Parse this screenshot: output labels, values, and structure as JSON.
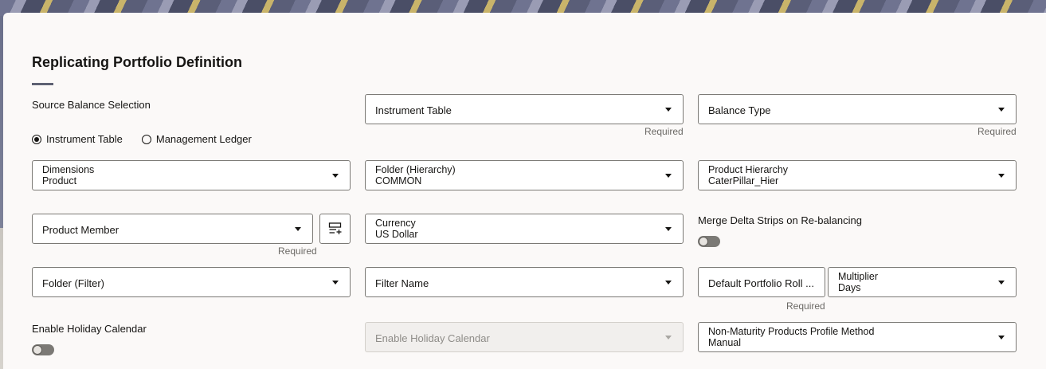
{
  "page": {
    "title": "Replicating Portfolio Definition"
  },
  "source_balance": {
    "label": "Source Balance Selection",
    "options": [
      "Instrument Table",
      "Management Ledger"
    ],
    "selected": "Instrument Table"
  },
  "instrument_table": {
    "label": "Instrument Table",
    "required": "Required"
  },
  "balance_type": {
    "label": "Balance Type",
    "required": "Required"
  },
  "dimensions": {
    "label": "Dimensions",
    "value": "Product"
  },
  "folder_hierarchy": {
    "label": "Folder (Hierarchy)",
    "value": "COMMON"
  },
  "product_hierarchy": {
    "label": "Product Hierarchy",
    "value": "CaterPillar_Hier"
  },
  "product_member": {
    "label": "Product Member",
    "required": "Required"
  },
  "currency": {
    "label": "Currency",
    "value": "US Dollar"
  },
  "merge_delta": {
    "label": "Merge Delta Strips on Re-balancing",
    "on": false
  },
  "folder_filter": {
    "label": "Folder (Filter)"
  },
  "filter_name": {
    "label": "Filter Name"
  },
  "default_roll": {
    "label": "Default Portfolio Roll ...",
    "required": "Required"
  },
  "multiplier": {
    "label": "Multiplier",
    "value": "Days"
  },
  "holiday_toggle": {
    "label": "Enable Holiday Calendar",
    "on": false
  },
  "holiday_select": {
    "label": "Enable Holiday Calendar",
    "disabled": true
  },
  "nmp_profile": {
    "label": "Non-Maturity Products Profile Method",
    "value": "Manual"
  },
  "icons": {
    "caret": "chevron-down-icon",
    "hierarchy_browser": "hierarchy-browser-icon"
  },
  "colors": {
    "panel": "#fbf9f8",
    "accent": "#5d6173",
    "border": "#7b7975"
  }
}
